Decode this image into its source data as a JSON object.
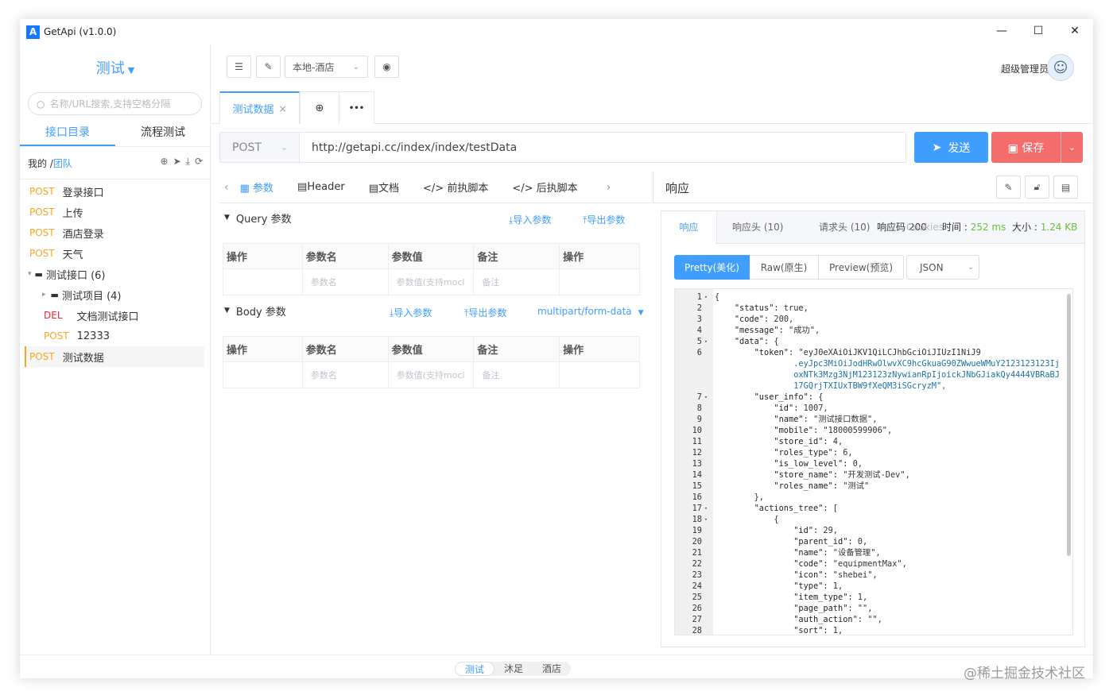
{
  "app": {
    "title": "GetApi (v1.0.0)",
    "logo": "A"
  },
  "window_controls": {
    "minimize": "—",
    "maximize": "☐",
    "close": "✕"
  },
  "sidebar": {
    "project": "测试",
    "search_placeholder": "名称/URL搜索,支持空格分隔",
    "tabs": [
      "接口目录",
      "流程测试"
    ],
    "crumb_mine": "我的 /",
    "crumb_team": "团队",
    "items": [
      {
        "method": "POST",
        "label": "登录接口"
      },
      {
        "method": "POST",
        "label": "上传"
      },
      {
        "method": "POST",
        "label": "酒店登录"
      },
      {
        "method": "POST",
        "label": "天气"
      },
      {
        "folder": "测试接口 (6)"
      },
      {
        "folder": "测试项目 (4)"
      },
      {
        "method": "DEL",
        "label": "文档测试接口"
      },
      {
        "method": "POST",
        "label": "12333"
      },
      {
        "method": "POST",
        "label": "测试数据"
      }
    ]
  },
  "topbar": {
    "env_select": "本地-酒店",
    "user_name": "超级管理员"
  },
  "doc_tabs": {
    "active": "测试数据",
    "close": "×",
    "add": "⊕",
    "more": "•••"
  },
  "request": {
    "method": "POST",
    "url": "http://getapi.cc/index/index/testData",
    "send_label": "发送",
    "save_label": "保存",
    "tabs": [
      "参数",
      "Header",
      "文档",
      "前执脚本",
      "后执脚本"
    ],
    "query_title": "Query 参数",
    "body_title": "Body 参数",
    "import_label": "导入参数",
    "export_label": "导出参数",
    "body_type": "multipart/form-data",
    "columns": [
      "操作",
      "参数名",
      "参数值",
      "备注",
      "操作"
    ],
    "name_placeholder": "参数名",
    "value_placeholder": "参数值(支持mocl",
    "note_placeholder": "备注"
  },
  "response": {
    "title": "响应",
    "tabs": {
      "resp": "响应",
      "headers": "响应头 (10)",
      "req_headers": "请求头 (10)",
      "cookies": "响应码 200",
      "cookies_label": "Cookies",
      "time_label": "时间 : ",
      "time": "252 ms",
      "size_label": "大小 : ",
      "size": "1.24 KB"
    },
    "view_buttons": [
      "Pretty(美化)",
      "Raw(原生)",
      "Preview(预览)",
      "JSON"
    ],
    "code": [
      {
        "n": "1",
        "f": "▾",
        "t": "{"
      },
      {
        "n": "2",
        "f": "",
        "t": "    \"status\": true,"
      },
      {
        "n": "3",
        "f": "",
        "t": "    \"code\": 200,"
      },
      {
        "n": "4",
        "f": "",
        "t": "    \"message\": \"成功\","
      },
      {
        "n": "5",
        "f": "▾",
        "t": "    \"data\": {"
      },
      {
        "n": "6",
        "f": "",
        "t": "        \"token\": \"eyJ0eXAiOiJKV1QiLCJhbGciOiJIUzI1NiJ9"
      },
      {
        "n": "",
        "f": "",
        "t": "                .eyJpc3MiOiJodHRwOlwvXC9hcGkuaG90ZWwueWMuY2123123123Ij"
      },
      {
        "n": "",
        "f": "",
        "t": "                oxNTk3Mzg3NjM123123zNywianRpIjoickJNbGJiakQy4444VBRaBJ"
      },
      {
        "n": "",
        "f": "",
        "t": "                17GQrjTXIUxTBW9fXeQM3iSGcryzM\","
      },
      {
        "n": "7",
        "f": "▾",
        "t": "        \"user_info\": {"
      },
      {
        "n": "8",
        "f": "",
        "t": "            \"id\": 1007,"
      },
      {
        "n": "9",
        "f": "",
        "t": "            \"name\": \"测试接口数据\","
      },
      {
        "n": "10",
        "f": "",
        "t": "            \"mobile\": \"18000599906\","
      },
      {
        "n": "11",
        "f": "",
        "t": "            \"store_id\": 4,"
      },
      {
        "n": "12",
        "f": "",
        "t": "            \"roles_type\": 6,"
      },
      {
        "n": "13",
        "f": "",
        "t": "            \"is_low_level\": 0,"
      },
      {
        "n": "14",
        "f": "",
        "t": "            \"store_name\": \"开发测试-Dev\","
      },
      {
        "n": "15",
        "f": "",
        "t": "            \"roles_name\": \"测试\""
      },
      {
        "n": "16",
        "f": "",
        "t": "        },"
      },
      {
        "n": "17",
        "f": "▾",
        "t": "        \"actions_tree\": ["
      },
      {
        "n": "18",
        "f": "▾",
        "t": "            {"
      },
      {
        "n": "19",
        "f": "",
        "t": "                \"id\": 29,"
      },
      {
        "n": "20",
        "f": "",
        "t": "                \"parent_id\": 0,"
      },
      {
        "n": "21",
        "f": "",
        "t": "                \"name\": \"设备管理\","
      },
      {
        "n": "22",
        "f": "",
        "t": "                \"code\": \"equipmentMax\","
      },
      {
        "n": "23",
        "f": "",
        "t": "                \"icon\": \"shebei\","
      },
      {
        "n": "24",
        "f": "",
        "t": "                \"type\": 1,"
      },
      {
        "n": "25",
        "f": "",
        "t": "                \"item_type\": 1,"
      },
      {
        "n": "26",
        "f": "",
        "t": "                \"page_path\": \"\","
      },
      {
        "n": "27",
        "f": "",
        "t": "                \"auth_action\": \"\","
      },
      {
        "n": "28",
        "f": "",
        "t": "                \"sort\": 1,"
      }
    ]
  },
  "footer": {
    "envs": [
      "测试",
      "沐足",
      "酒店"
    ],
    "watermark": "@稀土掘金技术社区"
  }
}
